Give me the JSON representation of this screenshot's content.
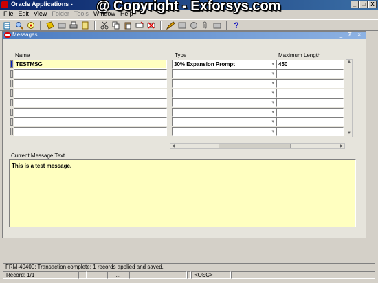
{
  "app": {
    "title": "Oracle Applications -",
    "watermark": "@ Copyright - Exforsys.com",
    "window_buttons": [
      "_",
      "□",
      "X"
    ]
  },
  "menu": {
    "items": [
      {
        "label": "File",
        "enabled": true
      },
      {
        "label": "Edit",
        "enabled": true
      },
      {
        "label": "View",
        "enabled": true
      },
      {
        "label": "Folder",
        "enabled": false
      },
      {
        "label": "Tools",
        "enabled": false
      },
      {
        "label": "Window",
        "enabled": true
      },
      {
        "label": "Help",
        "enabled": true
      }
    ]
  },
  "toolbar": {
    "icons": [
      "new-icon",
      "find-icon",
      "navigate-icon",
      "save-icon",
      "next-step-icon",
      "print-icon",
      "close-form-icon",
      "cut-icon",
      "copy-icon",
      "paste-icon",
      "new-record-icon",
      "delete-record-icon",
      "edit-field-icon",
      "zoom-icon",
      "translations-icon",
      "attachments-icon",
      "folder-tools-icon",
      "help-icon"
    ],
    "help_label": "?"
  },
  "form": {
    "title": "Messages",
    "controls": "_ ⊼ ×",
    "columns": {
      "name": "Name",
      "type": "Type",
      "max_length": "Maximum Length"
    },
    "rows": [
      {
        "name": "TESTMSG",
        "type": "30% Expansion Prompt",
        "max_length": "450"
      },
      {
        "name": "",
        "type": "",
        "max_length": ""
      },
      {
        "name": "",
        "type": "",
        "max_length": ""
      },
      {
        "name": "",
        "type": "",
        "max_length": ""
      },
      {
        "name": "",
        "type": "",
        "max_length": ""
      },
      {
        "name": "",
        "type": "",
        "max_length": ""
      },
      {
        "name": "",
        "type": "",
        "max_length": ""
      },
      {
        "name": "",
        "type": "",
        "max_length": ""
      }
    ],
    "message_label": "Current Message Text",
    "message_text": "This is a test message."
  },
  "status": {
    "message": "FRM-40400: Transaction complete: 1 records applied and saved.",
    "record": "Record: 1/1",
    "ellipsis": "...",
    "osc": "<OSC>"
  }
}
